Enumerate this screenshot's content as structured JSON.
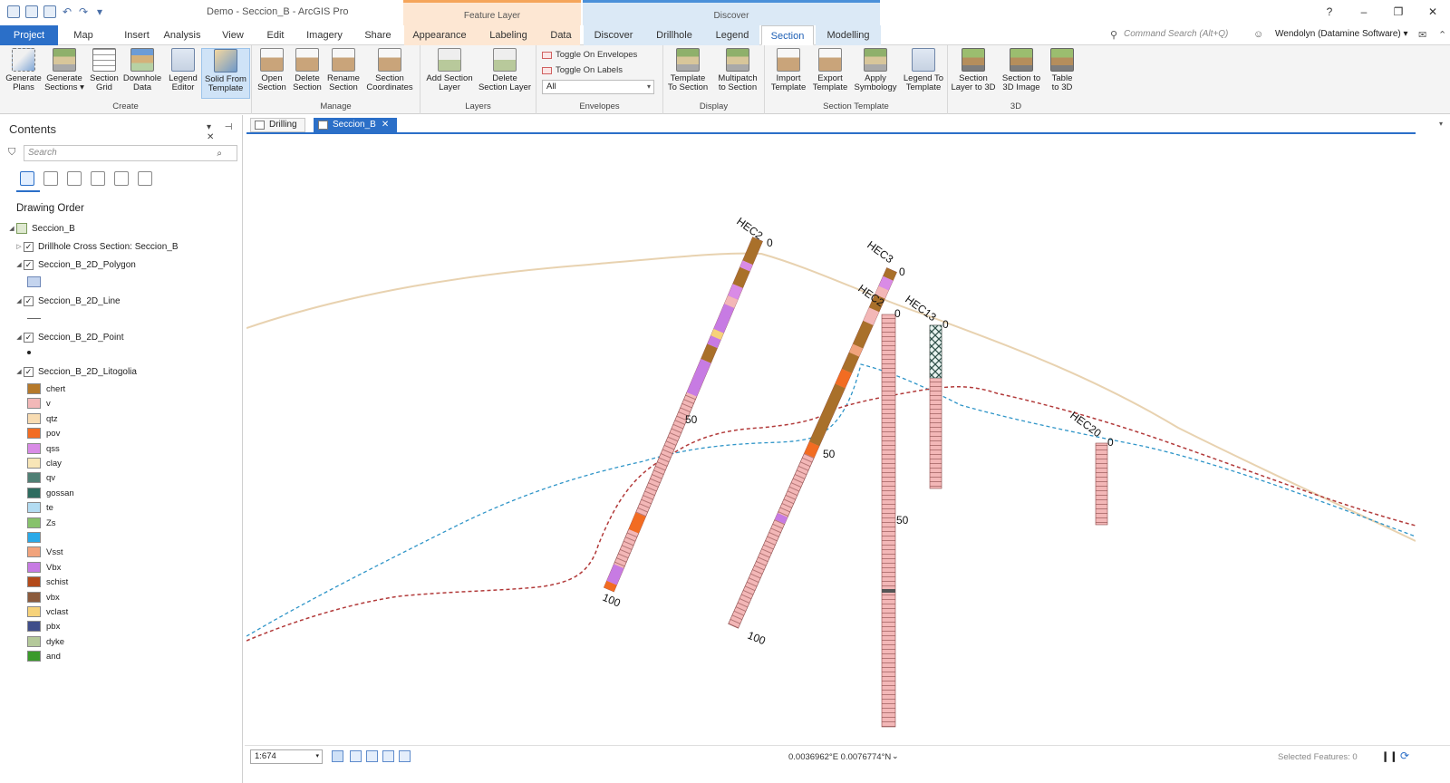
{
  "app": {
    "title": "Demo - Seccion_B - ArcGIS Pro",
    "context_feature": "Feature Layer",
    "context_discover": "Discover",
    "help": "?",
    "minimize": "–",
    "restore": "❐",
    "close": "✕"
  },
  "tabs": [
    "Project",
    "Map",
    "Insert",
    "Analysis",
    "View",
    "Edit",
    "Imagery",
    "Share",
    "Appearance",
    "Labeling",
    "Data",
    "Discover",
    "Drillhole",
    "Legend",
    "Section",
    "Modelling"
  ],
  "active_tab": "Section",
  "command_search": "Command Search (Alt+Q)",
  "user": "Wendolyn (Datamine Software) ▾",
  "ribbon": {
    "create": {
      "label": "Create",
      "buttons": [
        {
          "l1": "Generate",
          "l2": "Plans"
        },
        {
          "l1": "Generate",
          "l2": "Sections ▾"
        },
        {
          "l1": "Section",
          "l2": "Grid"
        },
        {
          "l1": "Downhole",
          "l2": "Data"
        },
        {
          "l1": "Legend",
          "l2": "Editor"
        },
        {
          "l1": "Solid From",
          "l2": "Template"
        }
      ]
    },
    "manage": {
      "label": "Manage",
      "buttons": [
        {
          "l1": "Open",
          "l2": "Section"
        },
        {
          "l1": "Delete",
          "l2": "Section"
        },
        {
          "l1": "Rename",
          "l2": "Section"
        },
        {
          "l1": "Section",
          "l2": "Coordinates"
        }
      ]
    },
    "layers": {
      "label": "Layers",
      "buttons": [
        {
          "l1": "Add Section",
          "l2": "Layer"
        },
        {
          "l1": "Delete",
          "l2": "Section Layer"
        }
      ]
    },
    "envelopes": {
      "label": "Envelopes",
      "toggle_envelopes": "Toggle On Envelopes",
      "toggle_labels": "Toggle On Labels",
      "select_value": "All"
    },
    "display": {
      "label": "Display",
      "buttons": [
        {
          "l1": "Template",
          "l2": "To Section"
        },
        {
          "l1": "Multipatch",
          "l2": "to Section"
        }
      ]
    },
    "section_template": {
      "label": "Section Template",
      "buttons": [
        {
          "l1": "Import",
          "l2": "Template"
        },
        {
          "l1": "Export",
          "l2": "Template"
        },
        {
          "l1": "Apply",
          "l2": "Symbology"
        },
        {
          "l1": "Legend To",
          "l2": "Template"
        }
      ]
    },
    "three_d": {
      "label": "3D",
      "buttons": [
        {
          "l1": "Section",
          "l2": "Layer to 3D"
        },
        {
          "l1": "Section to",
          "l2": "3D Image"
        },
        {
          "l1": "Table",
          "l2": "to 3D"
        }
      ]
    }
  },
  "contents": {
    "title": "Contents",
    "search_placeholder": "Search",
    "drawing_order": "Drawing Order",
    "map_name": "Seccion_B",
    "layers": [
      {
        "name": "Drillhole Cross Section: Seccion_B",
        "expander": "▷"
      },
      {
        "name": "Seccion_B_2D_Polygon",
        "expander": "◢"
      },
      {
        "name": "Seccion_B_2D_Line",
        "expander": "◢"
      },
      {
        "name": "Seccion_B_2D_Point",
        "expander": "◢"
      },
      {
        "name": "Seccion_B_2D_Litogolia",
        "expander": "◢"
      }
    ],
    "legend": [
      {
        "label": "chert",
        "color": "#b5792a"
      },
      {
        "label": "v",
        "color": "#f2b8b8"
      },
      {
        "label": "qtz",
        "color": "#f8dcb2"
      },
      {
        "label": "pov",
        "color": "#f26c22"
      },
      {
        "label": "qss",
        "color": "#d98be6"
      },
      {
        "label": "clay",
        "color": "#f8e6b7"
      },
      {
        "label": "qv",
        "color": "#4f7f74"
      },
      {
        "label": "gossan",
        "color": "#2e6b5f"
      },
      {
        "label": "te",
        "color": "#b3dcf2"
      },
      {
        "label": "Zs",
        "color": "#87c26b"
      },
      {
        "label": "",
        "color": "#29a9e8"
      },
      {
        "label": "Vsst",
        "color": "#f1a37c"
      },
      {
        "label": "Vbx",
        "color": "#c77be3"
      },
      {
        "label": "schist",
        "color": "#b34a1a"
      },
      {
        "label": "vbx",
        "color": "#8b5a3c"
      },
      {
        "label": "vclast",
        "color": "#f6d27a"
      },
      {
        "label": "pbx",
        "color": "#3f4d8a"
      },
      {
        "label": "dyke",
        "color": "#b4c99a"
      },
      {
        "label": "and",
        "color": "#3a9a2a"
      }
    ]
  },
  "map_tabs": [
    {
      "label": "Drilling"
    },
    {
      "label": "Seccion_B"
    }
  ],
  "map": {
    "holes": [
      {
        "name": "HEC2",
        "top": "0",
        "d50": "50",
        "d100": "100"
      },
      {
        "name": "HEC3",
        "top": "0",
        "d50": "50",
        "d100": "100"
      },
      {
        "name": "HEC2",
        "top": "0",
        "d50": "50"
      },
      {
        "name": "HEC13",
        "top": "0"
      },
      {
        "name": "HEC20",
        "top": "0"
      }
    ]
  },
  "status": {
    "scale": "1:674",
    "coords": "0.0036962°E 0.0076774°N",
    "selected": "Selected Features: 0"
  }
}
